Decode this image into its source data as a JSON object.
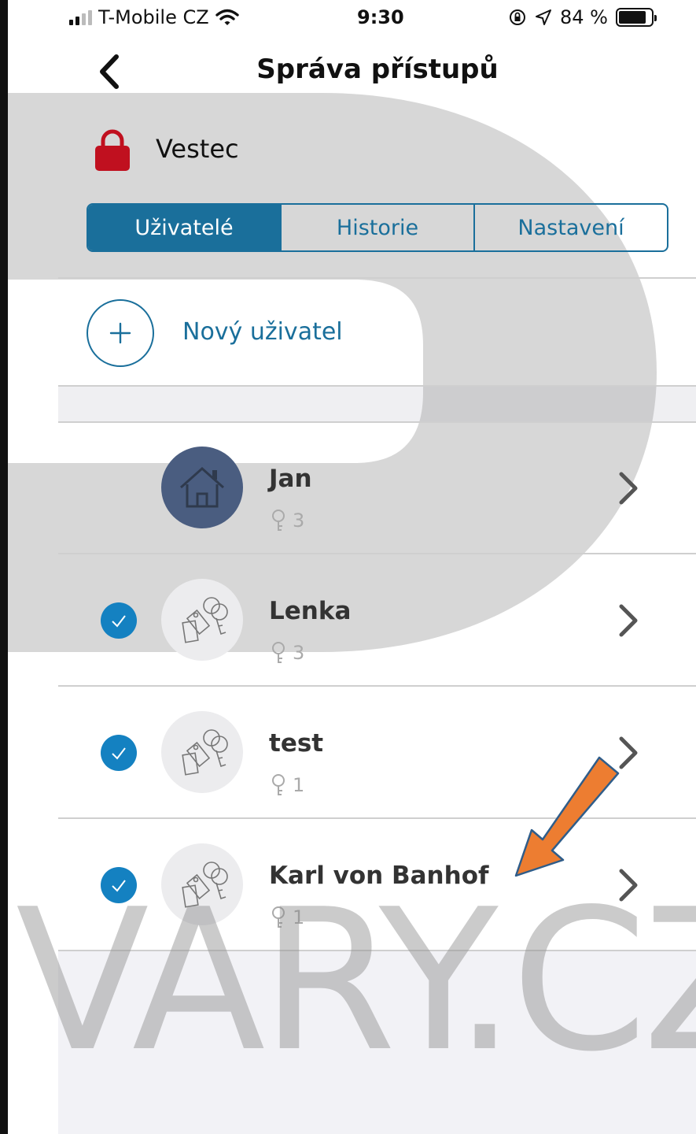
{
  "status_bar": {
    "carrier": "T-Mobile CZ",
    "time": "9:30",
    "battery": "84 %",
    "battery_level": 0.84
  },
  "nav": {
    "title": "Správa přístupů",
    "back_icon": "chevron-left-icon"
  },
  "lock": {
    "name": "Vestec",
    "icon": "lock-icon",
    "color": "#c0101f"
  },
  "tabs": [
    {
      "label": "Uživatelé",
      "active": true
    },
    {
      "label": "Historie",
      "active": false
    },
    {
      "label": "Nastavení",
      "active": false
    }
  ],
  "add_user": {
    "label": "Nový uživatel",
    "icon": "plus-icon"
  },
  "users": [
    {
      "name": "Jan",
      "keys": "3",
      "checked": false,
      "avatar": "home-icon"
    },
    {
      "name": "Lenka",
      "keys": "3",
      "checked": true,
      "avatar": "key-tags-icon"
    },
    {
      "name": "test",
      "keys": "1",
      "checked": true,
      "avatar": "key-tags-icon"
    },
    {
      "name": "Karl von Banhof",
      "keys": "1",
      "checked": true,
      "avatar": "key-tags-icon"
    }
  ],
  "watermark": "VARY.CZ",
  "colors": {
    "accent": "#1a6f9b",
    "check": "#1481c1",
    "lock": "#c0101f",
    "arrow": "#ed7d31"
  }
}
